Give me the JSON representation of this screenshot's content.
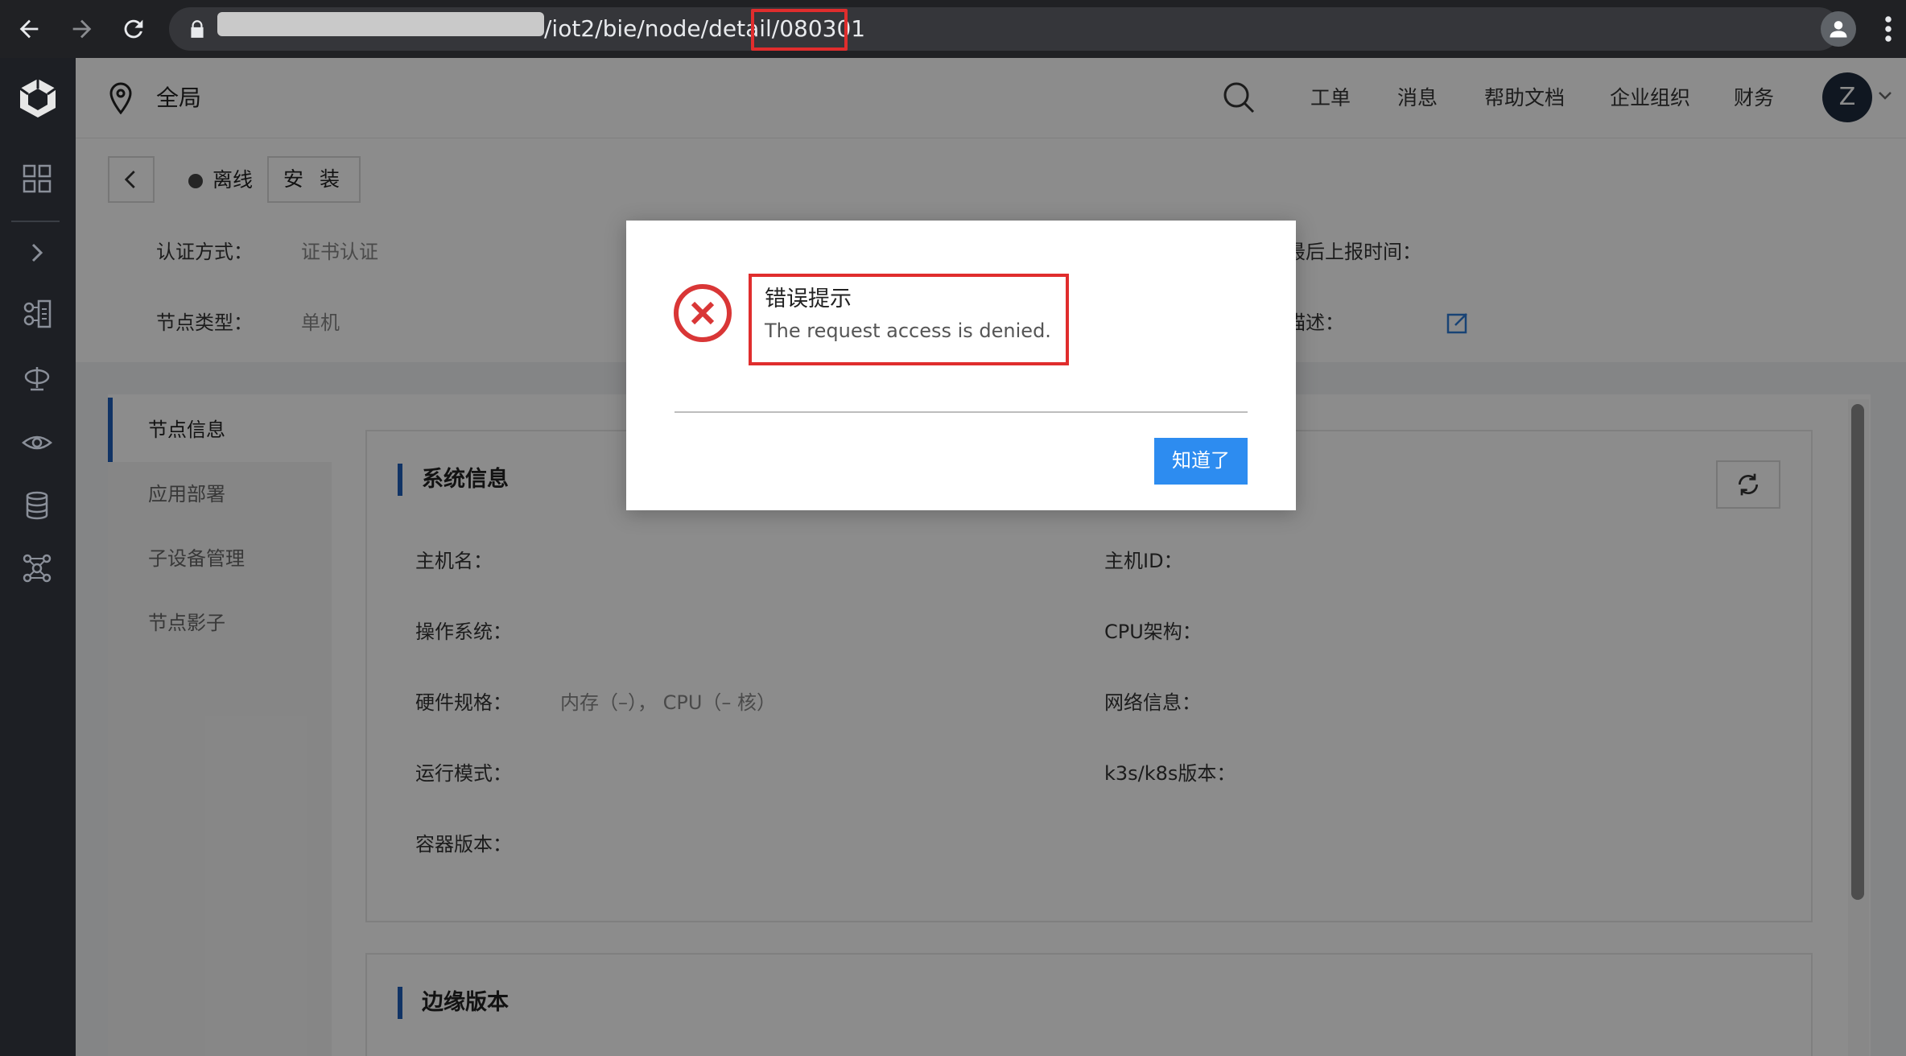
{
  "browser": {
    "url_visible": "/iot2/bie/node/detail/080301",
    "url_path": "/iot2/bie/node/detail/",
    "url_id": "080301"
  },
  "header": {
    "region": "全局",
    "links": [
      "工单",
      "消息",
      "帮助文档",
      "企业组织",
      "财务"
    ],
    "avatar_letter": "Z"
  },
  "node": {
    "status": "离线",
    "install_label": "安 装",
    "auth_label": "认证方式：",
    "auth_value": "证书认证",
    "type_label": "节点类型：",
    "type_value": "单机",
    "last_report_label": "最后上报时间：",
    "desc_label": "描述："
  },
  "tabs": [
    {
      "label": "节点信息",
      "active": true
    },
    {
      "label": "应用部署",
      "active": false
    },
    {
      "label": "子设备管理",
      "active": false
    },
    {
      "label": "节点影子",
      "active": false
    }
  ],
  "system_info": {
    "title": "系统信息",
    "fields_left": [
      {
        "label": "主机名：",
        "value": ""
      },
      {
        "label": "操作系统：",
        "value": ""
      },
      {
        "label": "硬件规格：",
        "value": "内存（–），  CPU（– 核）"
      },
      {
        "label": "运行模式：",
        "value": ""
      },
      {
        "label": "容器版本：",
        "value": ""
      }
    ],
    "fields_right": [
      {
        "label": "主机ID：",
        "value": ""
      },
      {
        "label": "CPU架构：",
        "value": ""
      },
      {
        "label": "网络信息：",
        "value": ""
      },
      {
        "label": "k3s/k8s版本：",
        "value": ""
      }
    ]
  },
  "edge_version": {
    "title": "边缘版本"
  },
  "modal": {
    "title": "错误提示",
    "message": "The request access is denied.",
    "ok_label": "知道了"
  },
  "colors": {
    "accent": "#1e5eb8",
    "primary_button": "#2d8cf0",
    "error": "#d93636",
    "highlight": "#e02d2d"
  }
}
